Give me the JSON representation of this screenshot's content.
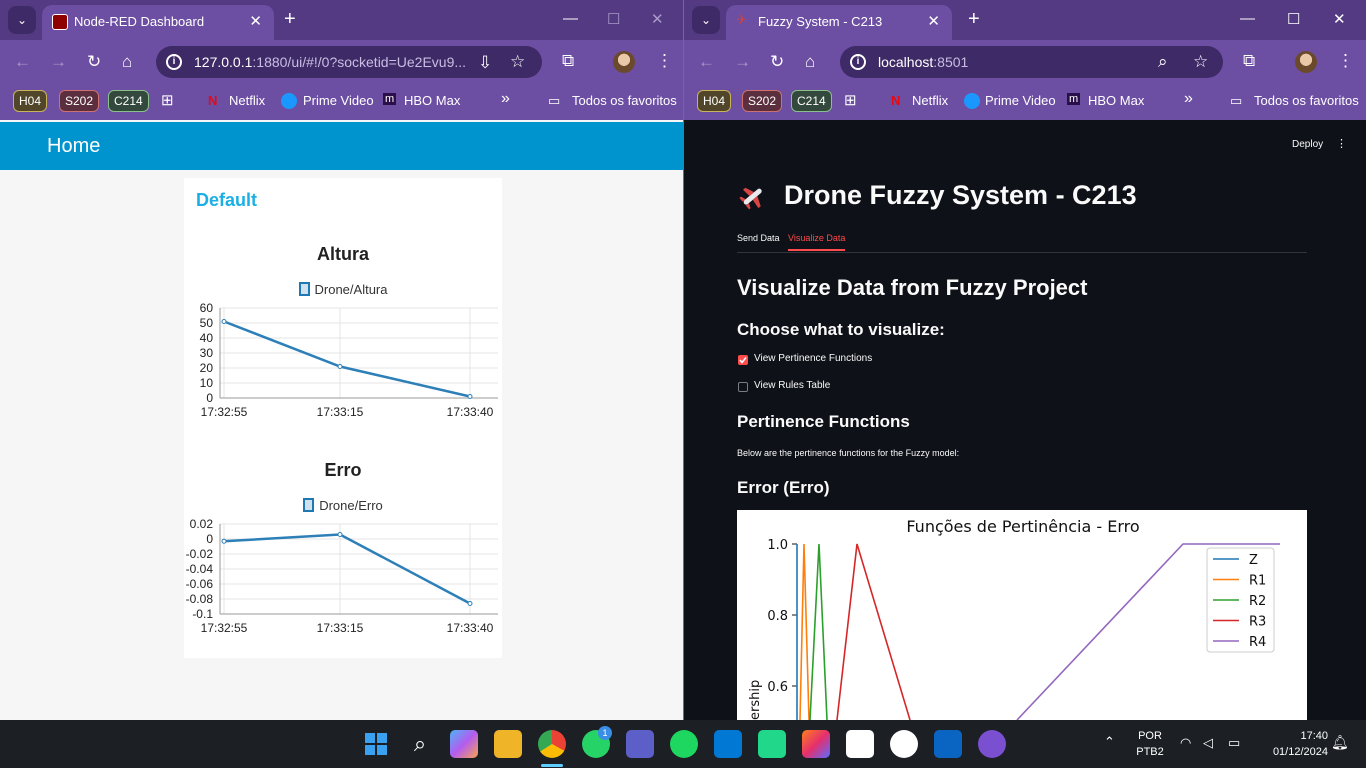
{
  "left_window": {
    "tab_title": "Node-RED Dashboard",
    "url_host": "127.0.0.1",
    "url_rest": ":1880/ui/#!/0?socketid=Ue2Evu9...",
    "dashboard": {
      "header": "Home",
      "group": "Default",
      "altura": {
        "title": "Altura",
        "legend": "Drone/Altura",
        "y_ticks": [
          "60",
          "50",
          "40",
          "30",
          "20",
          "10",
          "0"
        ],
        "x_ticks": [
          "17:32:55",
          "17:33:15",
          "17:33:40"
        ]
      },
      "erro": {
        "title": "Erro",
        "legend": "Drone/Erro",
        "y_ticks": [
          "0.02",
          "0",
          "-0.02",
          "-0.04",
          "-0.06",
          "-0.08",
          "-0.1"
        ],
        "x_ticks": [
          "17:32:55",
          "17:33:15",
          "17:33:40"
        ]
      }
    }
  },
  "right_window": {
    "tab_title": "Fuzzy System - C213",
    "url_host": "localhost",
    "url_rest": ":8501",
    "app": {
      "deploy": "Deploy",
      "title": "Drone Fuzzy System - C213",
      "tabs": [
        "Send Data",
        "Visualize Data"
      ],
      "active_tab": "Visualize Data",
      "h_visualize": "Visualize Data from Fuzzy Project",
      "h_choose": "Choose what to visualize:",
      "cb_pertinence": "View Pertinence Functions",
      "cb_pertinence_checked": true,
      "cb_rules": "View Rules Table",
      "cb_rules_checked": false,
      "h_pertinence": "Pertinence Functions",
      "desc": "Below are the pertinence functions for the Fuzzy model:",
      "h_error": "Error (Erro)",
      "plot": {
        "title": "Funções de Pertinência - Erro",
        "y_ticks": [
          "1.0",
          "0.8",
          "0.6"
        ],
        "ylabel_partial": "ership",
        "legend": [
          "Z",
          "R1",
          "R2",
          "R3",
          "R4"
        ]
      }
    }
  },
  "bookmarks": {
    "tags": [
      "H04",
      "S202",
      "C214"
    ],
    "netflix": "Netflix",
    "prime": "Prime Video",
    "hbo": "HBO Max",
    "more": "»",
    "all": "Todos os favoritos"
  },
  "taskbar": {
    "lang1": "POR",
    "lang2": "PTB2",
    "time": "17:40",
    "date": "01/12/2024",
    "whatsapp_badge": "1"
  },
  "chart_data": [
    {
      "type": "line",
      "title": "Altura",
      "series": [
        {
          "name": "Drone/Altura",
          "x": [
            "17:32:55",
            "17:33:15",
            "17:33:40"
          ],
          "values": [
            51,
            21,
            1
          ]
        }
      ],
      "ylim": [
        0,
        60
      ],
      "grid": true,
      "legend": "top"
    },
    {
      "type": "line",
      "title": "Erro",
      "series": [
        {
          "name": "Drone/Erro",
          "x": [
            "17:32:55",
            "17:33:15",
            "17:33:40"
          ],
          "values": [
            -0.003,
            0.006,
            -0.086
          ]
        }
      ],
      "ylim": [
        -0.1,
        0.02
      ],
      "grid": true,
      "legend": "top"
    },
    {
      "type": "line",
      "title": "Funções de Pertinência - Erro",
      "ylim_visible": [
        0.5,
        1.0
      ],
      "legend": "top-right",
      "series": [
        {
          "name": "Z",
          "color": "#1f77b4"
        },
        {
          "name": "R1",
          "color": "#ff7f0e"
        },
        {
          "name": "R2",
          "color": "#2ca02c"
        },
        {
          "name": "R3",
          "color": "#d62728"
        },
        {
          "name": "R4",
          "color": "#9467bd"
        }
      ]
    }
  ]
}
